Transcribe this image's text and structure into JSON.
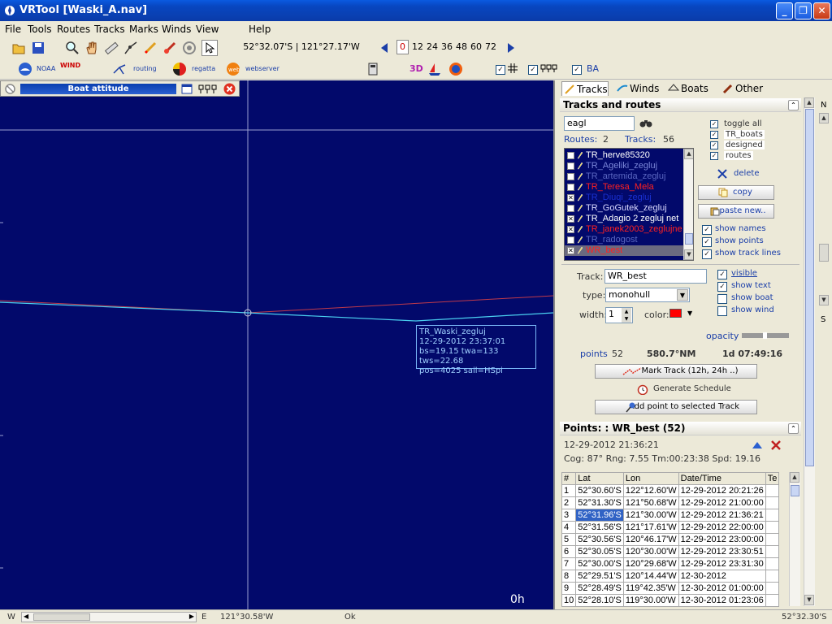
{
  "window": {
    "title": "VRTool [Waski_A.nav]"
  },
  "menu": [
    "File",
    "Tools",
    "Routes",
    "Tracks",
    "Marks",
    "Winds",
    "View",
    "Help"
  ],
  "toolbar": {
    "coord_readout": "52°32.07'S | 121°27.17'W",
    "hours": [
      "0",
      "12",
      "24",
      "36",
      "48",
      "60",
      "72"
    ],
    "hour_selected": "0",
    "noaa_label": "NOAA",
    "wind_label": "WIND",
    "routing_label": "routing",
    "regatta_label": "regatta",
    "webserver_label": "webserver",
    "btn_3d": "3D",
    "ba_label": "BA"
  },
  "map": {
    "boat_attitude_title": "Boat attitude",
    "tooltip": [
      "TR_Waski_zegluj",
      "12-29-2012 23:37:01",
      "bs=19.15 twa=133 tws=22.68",
      " pos=4025 sail=HSpi"
    ],
    "time_label": "0h"
  },
  "panel": {
    "tabs": [
      "Tracks",
      "Winds",
      "Boats",
      "Other"
    ],
    "tracks_header": "Tracks and routes",
    "filter_value": "eagl",
    "routes_label": "Routes:",
    "routes_count": "2",
    "tracks_label": "Tracks:",
    "tracks_count": "56",
    "track_list": [
      {
        "name": "TR_herve85320",
        "color": "#ffffff",
        "checked": false
      },
      {
        "name": "TR_Ageliki_zegluj",
        "color": "#7a86d8",
        "checked": false
      },
      {
        "name": "TR_artemida_zegluj",
        "color": "#5a66c0",
        "checked": false
      },
      {
        "name": "TR_Teresa_Mela",
        "color": "#ff2020",
        "checked": false
      },
      {
        "name": "TR_Diuqi_zegluj",
        "color": "#1a30d0",
        "checked": true
      },
      {
        "name": "TR_GoGutek_zegluj",
        "color": "#d8d8ff",
        "checked": false
      },
      {
        "name": "TR_Adagio 2 zegluj net",
        "color": "#ffffff",
        "checked": true
      },
      {
        "name": "TR_janek2003_zeglujne",
        "color": "#ff2020",
        "checked": true
      },
      {
        "name": "TR_radogost",
        "color": "#5a66c0",
        "checked": false
      },
      {
        "name": "WR_best",
        "color": "#ff2020",
        "checked": true
      }
    ],
    "toggles": [
      "toggle all",
      "TR_boats",
      "designed",
      "routes"
    ],
    "delete_label": "delete",
    "copy_label": "copy",
    "paste_label": "paste new..",
    "show_names": "show names",
    "show_points": "show points",
    "show_track_lines": "show track lines",
    "track_label": "Track:",
    "track_value": "WR_best",
    "type_label": "type:",
    "type_value": "monohull",
    "width_label": "width:",
    "width_value": "1",
    "color_label": "color:",
    "track_color": "#ff0000",
    "visible_label": "visible",
    "show_text_label": "show text",
    "show_boat_label": "show boat",
    "show_wind_label": "show wind",
    "opacity_label": "opacity",
    "points_label": "points",
    "points_value": "52",
    "distance_value": "580.7°NM",
    "duration_value": "1d 07:49:16",
    "mark_track_label": "Mark Track (12h, 24h ..)",
    "gen_schedule_label": "Generate Schedule",
    "add_point_label": "Add point to selected Track",
    "points_header": "Points: : WR_best (52)",
    "point_datetime": "12-29-2012 21:36:21",
    "point_info": "Cog: 87° Rng:  7.55 Tm:00:23:38 Spd: 19.16",
    "table_headers": [
      "#",
      "Lat",
      "Lon",
      "Date/Time",
      "Te"
    ],
    "table_rows": [
      [
        "1",
        "52°30.60'S",
        "122°12.60'W",
        "12-29-2012 20:21:26"
      ],
      [
        "2",
        "52°31.30'S",
        "121°50.68'W",
        "12-29-2012 21:00:00"
      ],
      [
        "3",
        "52°31.96'S",
        "121°30.00'W",
        "12-29-2012 21:36:21"
      ],
      [
        "4",
        "52°31.56'S",
        "121°17.61'W",
        "12-29-2012 22:00:00"
      ],
      [
        "5",
        "52°30.56'S",
        "120°46.17'W",
        "12-29-2012 23:00:00"
      ],
      [
        "6",
        "52°30.05'S",
        "120°30.00'W",
        "12-29-2012 23:30:51"
      ],
      [
        "7",
        "52°30.00'S",
        "120°29.68'W",
        "12-29-2012 23:31:30"
      ],
      [
        "8",
        "52°29.51'S",
        "120°14.44'W",
        "12-30-2012"
      ],
      [
        "9",
        "52°28.49'S",
        "119°42.35'W",
        "12-30-2012 01:00:00"
      ],
      [
        "10",
        "52°28.10'S",
        "119°30.00'W",
        "12-30-2012 01:23:06"
      ]
    ]
  },
  "compass": {
    "n": "N",
    "s": "S"
  },
  "status": {
    "w": "W",
    "e": "E",
    "lon": "121°30.58'W",
    "ok": "Ok",
    "lat": "52°32.30'S"
  }
}
